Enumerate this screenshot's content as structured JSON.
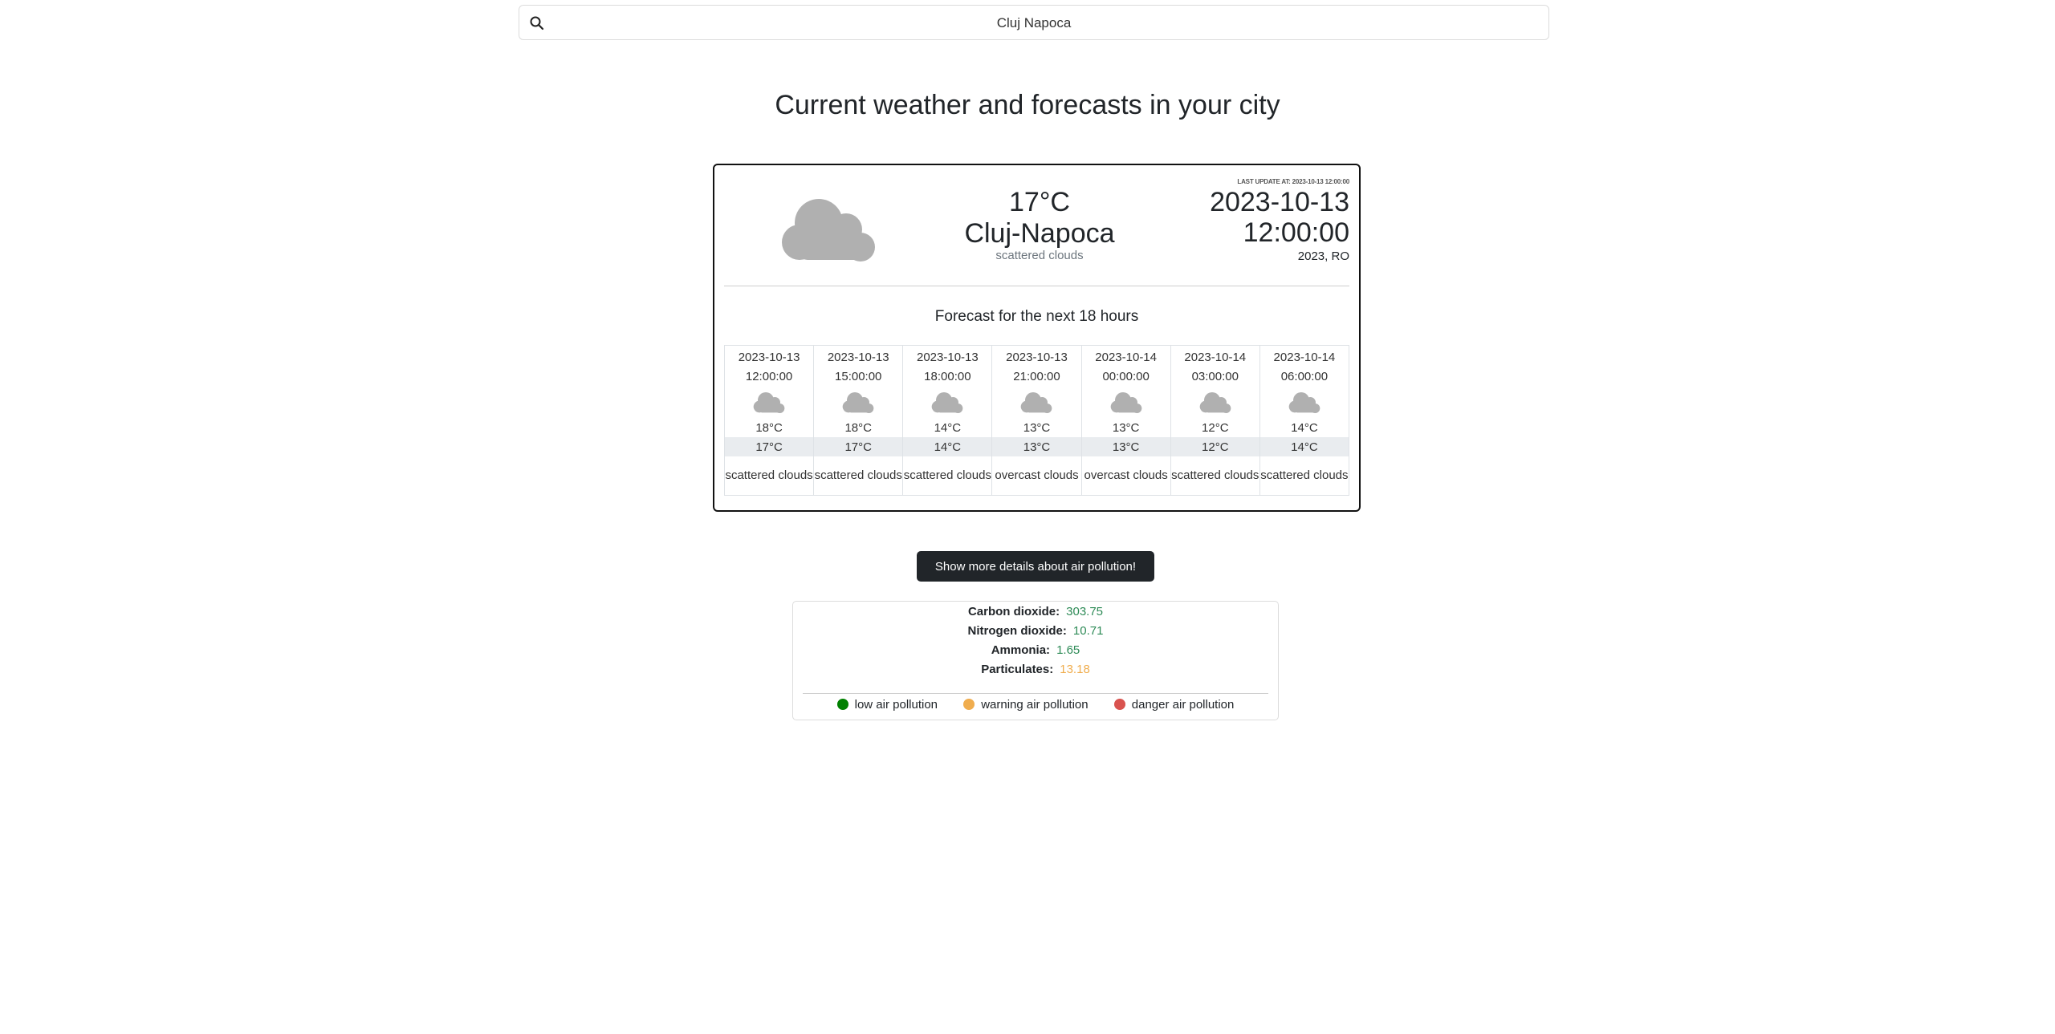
{
  "search": {
    "value": "Cluj Napoca"
  },
  "page_title": "Current weather and forecasts in your city",
  "current": {
    "temp": "17°C",
    "city": "Cluj-Napoca",
    "description": "scattered clouds",
    "icon": "cloud-icon",
    "last_update_label": "LAST UPDATE AT: 2023-10-13 12:00:00",
    "date": "2023-10-13",
    "time": "12:00:00",
    "country": "2023, RO"
  },
  "forecast": {
    "title": "Forecast for the next 18 hours",
    "items": [
      {
        "date": "2023-10-13",
        "time": "12:00:00",
        "temp": "18°C",
        "feels": "17°C",
        "desc": "scattered clouds"
      },
      {
        "date": "2023-10-13",
        "time": "15:00:00",
        "temp": "18°C",
        "feels": "17°C",
        "desc": "scattered clouds"
      },
      {
        "date": "2023-10-13",
        "time": "18:00:00",
        "temp": "14°C",
        "feels": "14°C",
        "desc": "scattered clouds"
      },
      {
        "date": "2023-10-13",
        "time": "21:00:00",
        "temp": "13°C",
        "feels": "13°C",
        "desc": "overcast clouds"
      },
      {
        "date": "2023-10-14",
        "time": "00:00:00",
        "temp": "13°C",
        "feels": "13°C",
        "desc": "overcast clouds"
      },
      {
        "date": "2023-10-14",
        "time": "03:00:00",
        "temp": "12°C",
        "feels": "12°C",
        "desc": "scattered clouds"
      },
      {
        "date": "2023-10-14",
        "time": "06:00:00",
        "temp": "14°C",
        "feels": "14°C",
        "desc": "scattered clouds"
      }
    ]
  },
  "pollution": {
    "button_label": "Show more details about air pollution!",
    "rows": [
      {
        "label": "Carbon dioxide:",
        "value": "303.75",
        "level": "low"
      },
      {
        "label": "Nitrogen dioxide:",
        "value": "10.71",
        "level": "low"
      },
      {
        "label": "Ammonia:",
        "value": "1.65",
        "level": "low"
      },
      {
        "label": "Particulates:",
        "value": "13.18",
        "level": "warning"
      }
    ],
    "legend": [
      {
        "label": "low air pollution",
        "color": "#008000"
      },
      {
        "label": "warning air pollution",
        "color": "#f0ad4e"
      },
      {
        "label": "danger air pollution",
        "color": "#d9534f"
      }
    ]
  },
  "colors": {
    "cloud": "#b0b0b0",
    "button_bg": "#212529"
  }
}
